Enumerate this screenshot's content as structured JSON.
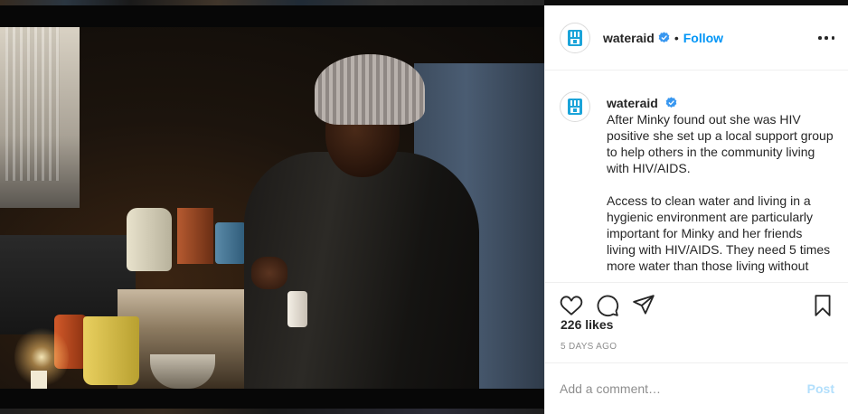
{
  "post": {
    "account": "wateraid",
    "follow_label": "Follow",
    "separator": "•",
    "caption": "After Minky found out she was HIV positive she set up a local support group to help others in the community living with HIV/AIDS.\n\nAccess to clean water and living in a hygienic environment are particularly important for Minky and her friends living with HIV/AIDS. They need 5 times more water than those living without",
    "likes": "226 likes",
    "timestamp": "5 DAYS AGO"
  },
  "comment": {
    "placeholder": "Add a comment…",
    "post_label": "Post"
  },
  "icons": {
    "more": "more-horizontal-icon",
    "verified": "verified-badge-icon",
    "like": "heart-icon",
    "comment": "comment-bubble-icon",
    "share": "paper-plane-icon",
    "save": "bookmark-icon"
  },
  "colors": {
    "link_blue": "#0095f6",
    "verified_blue": "#3897f0",
    "post_disabled": "#b2dffc",
    "muted_text": "#8e8e8e",
    "brand_logo": "#1ca4d9"
  }
}
